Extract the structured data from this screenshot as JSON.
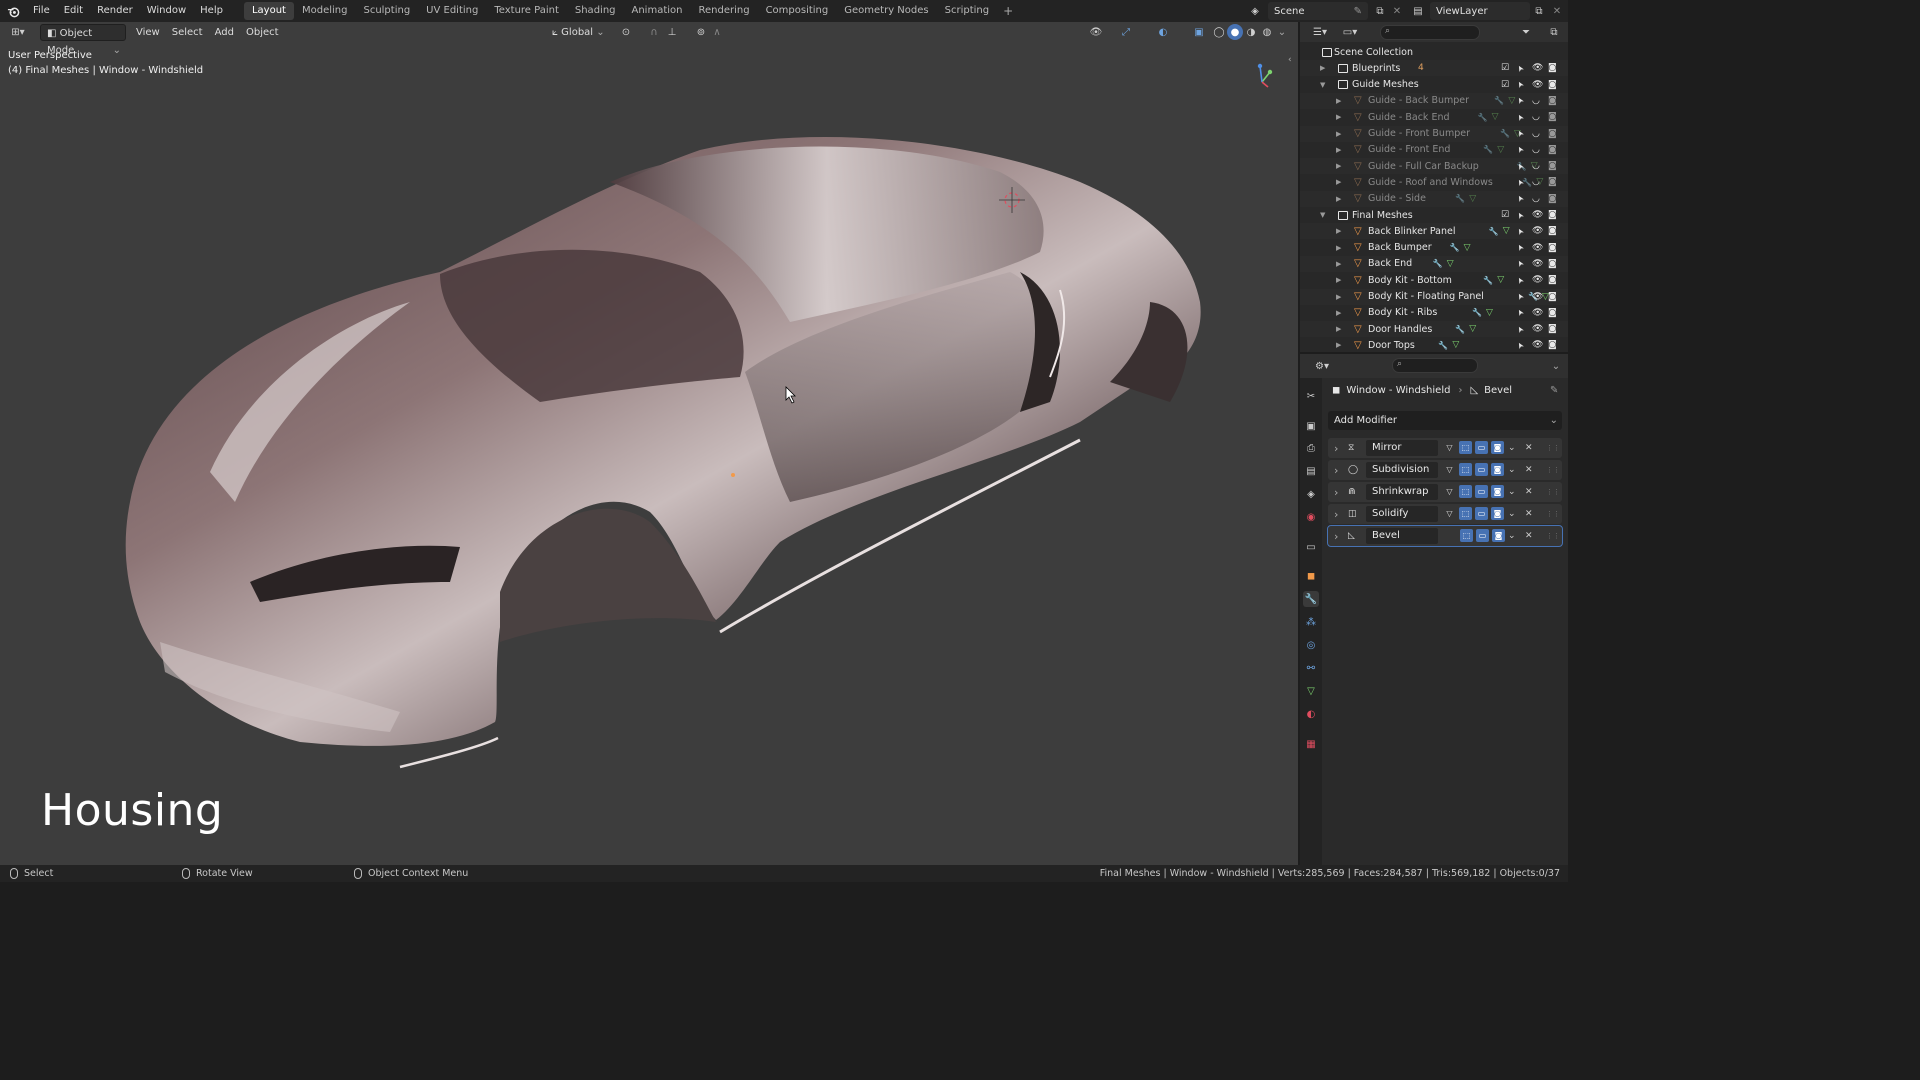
{
  "topbar": {
    "menus": [
      "File",
      "Edit",
      "Render",
      "Window",
      "Help"
    ],
    "workspaces": [
      "Layout",
      "Modeling",
      "Sculpting",
      "UV Editing",
      "Texture Paint",
      "Shading",
      "Animation",
      "Rendering",
      "Compositing",
      "Geometry Nodes",
      "Scripting"
    ],
    "active_workspace": "Layout",
    "add_tab": "+",
    "scene": "Scene",
    "view_layer": "ViewLayer"
  },
  "viewport": {
    "mode": "Object Mode",
    "menus": [
      "View",
      "Select",
      "Add",
      "Object"
    ],
    "transform_orientation": "Global",
    "perspective_label": "User Perspective",
    "object_info": "(4) Final Meshes | Window - Windshield",
    "overlay_title": "Housing"
  },
  "outliner": {
    "root": "Scene Collection",
    "rows": [
      {
        "label": "Blueprints",
        "kind": "collection",
        "expanded": false,
        "dim": false,
        "badge": "4"
      },
      {
        "label": "Guide Meshes",
        "kind": "collection",
        "expanded": true,
        "dim": false
      },
      {
        "label": "Guide - Back Bumper",
        "kind": "mesh",
        "dim": true
      },
      {
        "label": "Guide - Back End",
        "kind": "mesh",
        "dim": true
      },
      {
        "label": "Guide - Front Bumper",
        "kind": "mesh",
        "dim": true
      },
      {
        "label": "Guide - Front End",
        "kind": "mesh",
        "dim": true
      },
      {
        "label": "Guide - Full Car Backup",
        "kind": "mesh",
        "dim": true
      },
      {
        "label": "Guide - Roof and Windows",
        "kind": "mesh",
        "dim": true
      },
      {
        "label": "Guide - Side",
        "kind": "mesh",
        "dim": true
      },
      {
        "label": "Final Meshes",
        "kind": "collection",
        "expanded": true,
        "dim": false
      },
      {
        "label": "Back Blinker Panel",
        "kind": "mesh",
        "dim": false
      },
      {
        "label": "Back Bumper",
        "kind": "mesh",
        "dim": false
      },
      {
        "label": "Back End",
        "kind": "mesh",
        "dim": false
      },
      {
        "label": "Body Kit - Bottom",
        "kind": "mesh",
        "dim": false
      },
      {
        "label": "Body Kit - Floating Panel",
        "kind": "mesh",
        "dim": false
      },
      {
        "label": "Body Kit - Ribs",
        "kind": "mesh",
        "dim": false
      },
      {
        "label": "Door Handles",
        "kind": "mesh",
        "dim": false
      },
      {
        "label": "Door Tops",
        "kind": "mesh",
        "dim": false
      }
    ]
  },
  "properties": {
    "breadcrumb_object": "Window - Windshield",
    "breadcrumb_modifier": "Bevel",
    "add_modifier": "Add Modifier",
    "modifiers": [
      "Mirror",
      "Subdivision",
      "Shrinkwrap",
      "Solidify",
      "Bevel"
    ]
  },
  "statusbar": {
    "select": "Select",
    "rotate": "Rotate View",
    "context_menu": "Object Context Menu",
    "stats": "Final Meshes | Window - Windshield | Verts:285,569 | Faces:284,587 | Tris:569,182 | Objects:0/37"
  },
  "colors": {
    "accent_blue": "#4772b3",
    "viewport_bg": "#3d3d3d",
    "mesh_orange": "#f29a4a",
    "mesh_data_green": "#7dd36f",
    "modifier_wrench": "#6ea4e0"
  }
}
